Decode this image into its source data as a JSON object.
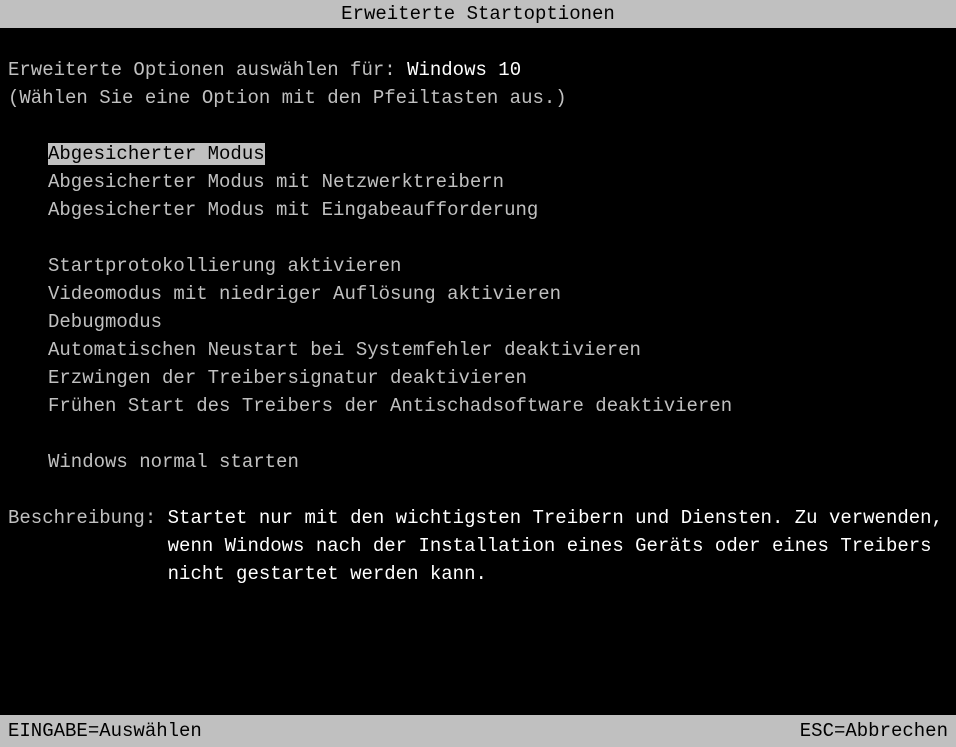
{
  "header": {
    "title": "Erweiterte Startoptionen"
  },
  "prompt": {
    "prefix": "Erweiterte Optionen auswählen für: ",
    "os": "Windows 10",
    "instruction": "(Wählen Sie eine Option mit den Pfeiltasten aus.)"
  },
  "menu": {
    "groups": [
      [
        "Abgesicherter Modus",
        "Abgesicherter Modus mit Netzwerktreibern",
        "Abgesicherter Modus mit Eingabeaufforderung"
      ],
      [
        "Startprotokollierung aktivieren",
        "Videomodus mit niedriger Auflösung aktivieren",
        "Debugmodus",
        "Automatischen Neustart bei Systemfehler deaktivieren",
        "Erzwingen der Treibersignatur deaktivieren",
        "Frühen Start des Treibers der Antischadsoftware deaktivieren"
      ],
      [
        "Windows normal starten"
      ]
    ],
    "selected": "Abgesicherter Modus"
  },
  "description": {
    "label": "Beschreibung: ",
    "text": "Startet nur mit den wichtigsten Treibern und Diensten. Zu verwenden, wenn Windows nach der Installation eines Geräts oder eines Treibers nicht gestartet werden kann."
  },
  "footer": {
    "select": "EINGABE=Auswählen",
    "cancel": "ESC=Abbrechen"
  }
}
